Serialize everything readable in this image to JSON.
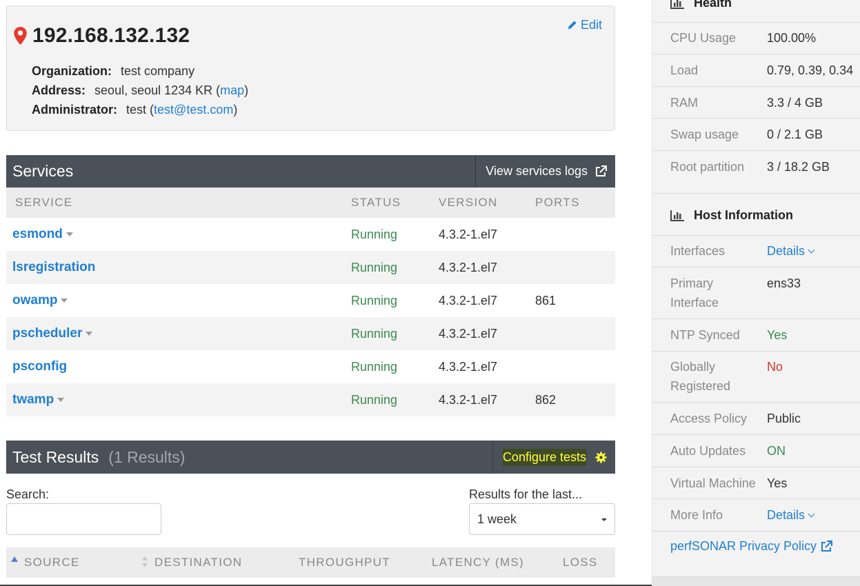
{
  "host": {
    "ip": "192.168.132.132",
    "edit_label": "Edit",
    "organization_label": "Organization:",
    "organization": "test company",
    "address_label": "Address:",
    "address": "seoul, seoul 1234 KR (",
    "map_link": "map",
    "address_close": ")",
    "admin_label": "Administrator:",
    "admin": "test (",
    "admin_email": "test@test.com",
    "admin_close": ")"
  },
  "services": {
    "title": "Services",
    "logs_label": "View services logs",
    "columns": [
      "SERVICE",
      "STATUS",
      "VERSION",
      "PORTS"
    ],
    "rows": [
      {
        "name": "esmond",
        "status": "Running",
        "version": "4.3.2-1.el7",
        "ports": ""
      },
      {
        "name": "lsregistration",
        "status": "Running",
        "version": "4.3.2-1.el7",
        "ports": ""
      },
      {
        "name": "owamp",
        "status": "Running",
        "version": "4.3.2-1.el7",
        "ports": "861"
      },
      {
        "name": "pscheduler",
        "status": "Running",
        "version": "4.3.2-1.el7",
        "ports": ""
      },
      {
        "name": "psconfig",
        "status": "Running",
        "version": "4.3.2-1.el7",
        "ports": ""
      },
      {
        "name": "twamp",
        "status": "Running",
        "version": "4.3.2-1.el7",
        "ports": "862"
      }
    ]
  },
  "tests": {
    "title": "Test Results",
    "count": "(1 Results)",
    "configure_label": "Configure tests",
    "search_label": "Search:",
    "search_value": "",
    "range_label": "Results for the last...",
    "range_value": "1 week",
    "columns": [
      "SOURCE",
      "DESTINATION",
      "THROUGHPUT",
      "LATENCY (MS)",
      "LOSS"
    ]
  },
  "sidebar": {
    "health_title": "Health",
    "health": [
      {
        "k": "CPU Usage",
        "v": "100.00%"
      },
      {
        "k": "Load",
        "v": "0.79, 0.39, 0.34"
      },
      {
        "k": "RAM",
        "v": "3.3 / 4 GB"
      },
      {
        "k": "Swap usage",
        "v": "0 / 2.1 GB"
      },
      {
        "k": "Root partition",
        "v": "3 / 18.2 GB"
      }
    ],
    "host_info_title": "Host Information",
    "host_info": [
      {
        "k": "Interfaces",
        "v": "Details"
      },
      {
        "k1": "Primary",
        "k2": "Interface",
        "v": "ens33"
      },
      {
        "k": "NTP Synced",
        "v": "Yes"
      },
      {
        "k1": "Globally",
        "k2": "Registered",
        "v": "No"
      },
      {
        "k": "Access Policy",
        "v": "Public"
      },
      {
        "k": "Auto Updates",
        "v": "ON"
      },
      {
        "k": "Virtual Machine",
        "v": "Yes"
      },
      {
        "k": "More Info",
        "v": "Details"
      }
    ],
    "privacy_label": "perfSONAR Privacy Policy"
  },
  "colors": {
    "accent": "#1f7fd5",
    "running": "#3a8a50",
    "header_bg": "#4a5158",
    "negative": "#d9342b",
    "highlight": "#ffff3a"
  }
}
